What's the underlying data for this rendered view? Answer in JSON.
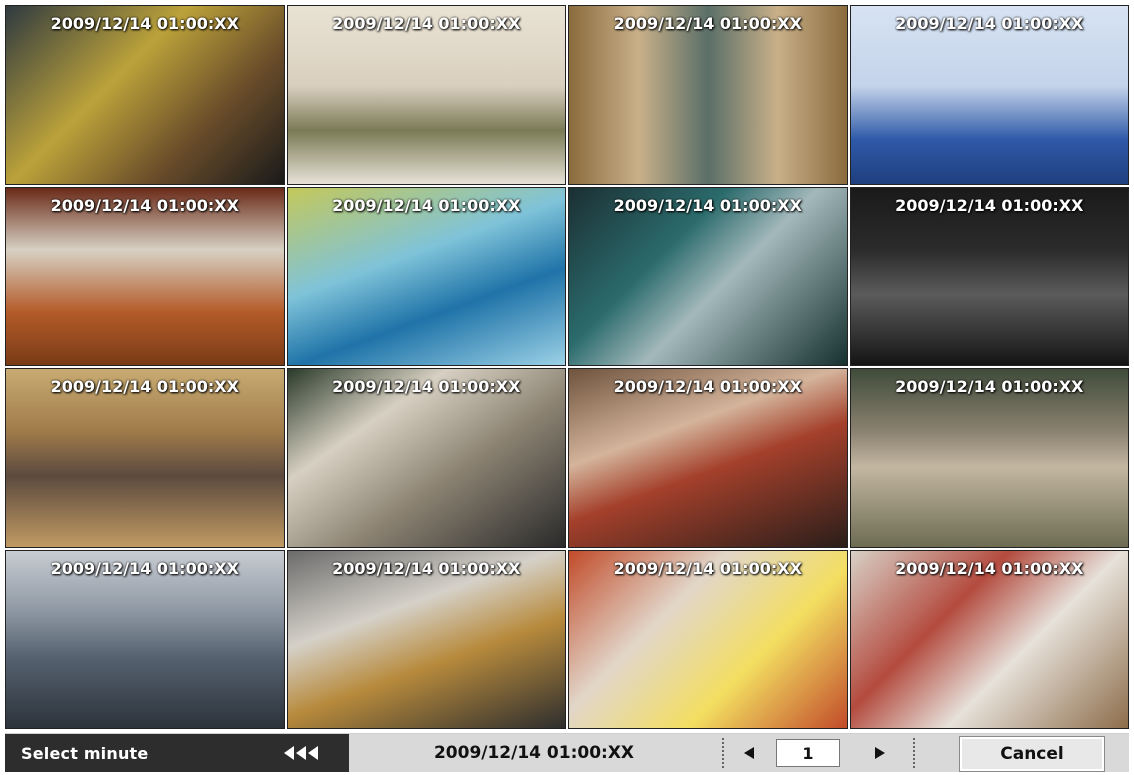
{
  "grid": {
    "tiles": [
      {
        "timestamp": "2009/12/14 01:00:XX"
      },
      {
        "timestamp": "2009/12/14 01:00:XX"
      },
      {
        "timestamp": "2009/12/14 01:00:XX"
      },
      {
        "timestamp": "2009/12/14 01:00:XX"
      },
      {
        "timestamp": "2009/12/14 01:00:XX"
      },
      {
        "timestamp": "2009/12/14 01:00:XX"
      },
      {
        "timestamp": "2009/12/14 01:00:XX"
      },
      {
        "timestamp": "2009/12/14 01:00:XX"
      },
      {
        "timestamp": "2009/12/14 01:00:XX"
      },
      {
        "timestamp": "2009/12/14 01:00:XX"
      },
      {
        "timestamp": "2009/12/14 01:00:XX"
      },
      {
        "timestamp": "2009/12/14 01:00:XX"
      },
      {
        "timestamp": "2009/12/14 01:00:XX"
      },
      {
        "timestamp": "2009/12/14 01:00:XX"
      },
      {
        "timestamp": "2009/12/14 01:00:XX"
      },
      {
        "timestamp": "2009/12/14 01:00:XX"
      }
    ]
  },
  "bottom_bar": {
    "select_label": "Select minute",
    "rewind_icon": "triple-left-arrow-icon",
    "current_datetime": "2009/12/14 01:00:XX",
    "prev_icon": "left-triangle-icon",
    "page_value": "1",
    "next_icon": "right-triangle-icon",
    "cancel_label": "Cancel"
  }
}
